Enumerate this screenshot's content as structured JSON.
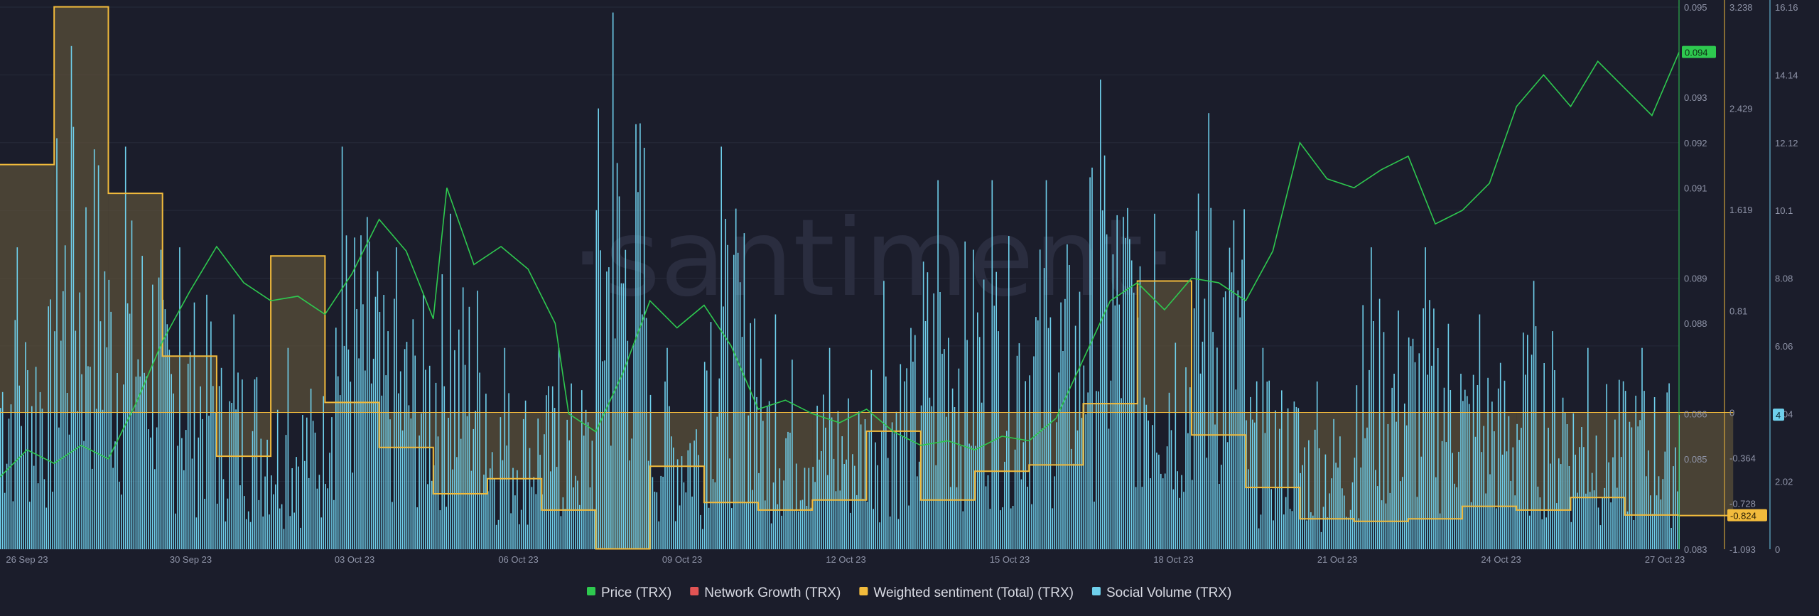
{
  "watermark": "·santiment·",
  "colors": {
    "background": "#1b1d2b",
    "grid": "#262a3b",
    "price": "#2ec94f",
    "network_growth": "#e25454",
    "sentiment": "#f2bb3c",
    "sentiment_fill": "#5a4f3a",
    "social_volume": "#6fd0ec",
    "tick_text": "#8f94a8"
  },
  "chart_data": {
    "type": "line",
    "title": "",
    "x_axis": {
      "type": "date",
      "range": [
        "2023-09-26",
        "2023-10-27"
      ],
      "tick_labels": [
        "26 Sep 23",
        "30 Sep 23",
        "03 Oct 23",
        "06 Oct 23",
        "09 Oct 23",
        "12 Oct 23",
        "15 Oct 23",
        "18 Oct 23",
        "21 Oct 23",
        "24 Oct 23",
        "27 Oct 23"
      ]
    },
    "y_axes": {
      "price": {
        "range": [
          0.083,
          0.095
        ],
        "tick_labels": [
          "0.095",
          "0.093",
          "0.092",
          "0.091",
          "0.089",
          "0.088",
          "0.086",
          "0.085",
          "0.083"
        ],
        "current_value_label": "0.094"
      },
      "sentiment": {
        "range": [
          -1.093,
          3.238
        ],
        "tick_labels": [
          "3.238",
          "2.429",
          "1.619",
          "0.81",
          "0",
          "-0.364",
          "-0.728",
          "-1.093"
        ],
        "current_value_label": "-0.824"
      },
      "social_volume": {
        "range": [
          0,
          16.16
        ],
        "tick_labels": [
          "16.16",
          "14.14",
          "12.12",
          "10.1",
          "8.08",
          "6.06",
          "4.04",
          "2.02",
          "0"
        ],
        "current_value_label": "4"
      }
    },
    "legend": {
      "placement": "bottom-center",
      "entries": [
        {
          "name": "Price (TRX)",
          "color": "#2ec94f"
        },
        {
          "name": "Network Growth (TRX)",
          "color": "#e25454"
        },
        {
          "name": "Weighted sentiment (Total) (TRX)",
          "color": "#f2bb3c"
        },
        {
          "name": "Social Volume (TRX)",
          "color": "#6fd0ec"
        }
      ]
    },
    "series": [
      {
        "name": "Price (TRX)",
        "type": "line",
        "axis": "price",
        "points": [
          [
            "2023-09-26T00:00",
            0.0846
          ],
          [
            "2023-09-26T12:00",
            0.0852
          ],
          [
            "2023-09-27T00:00",
            0.0849
          ],
          [
            "2023-09-27T12:00",
            0.0853
          ],
          [
            "2023-09-28T00:00",
            0.085
          ],
          [
            "2023-09-28T12:00",
            0.0862
          ],
          [
            "2023-09-29T00:00",
            0.0876
          ],
          [
            "2023-09-29T12:00",
            0.0887
          ],
          [
            "2023-09-30T00:00",
            0.0897
          ],
          [
            "2023-09-30T12:00",
            0.0889
          ],
          [
            "2023-10-01T00:00",
            0.0885
          ],
          [
            "2023-10-01T12:00",
            0.0886
          ],
          [
            "2023-10-02T00:00",
            0.0882
          ],
          [
            "2023-10-02T12:00",
            0.0891
          ],
          [
            "2023-10-03T00:00",
            0.0903
          ],
          [
            "2023-10-03T12:00",
            0.0896
          ],
          [
            "2023-10-04T00:00",
            0.0881
          ],
          [
            "2023-10-04T06:00",
            0.091
          ],
          [
            "2023-10-04T18:00",
            0.0893
          ],
          [
            "2023-10-05T06:00",
            0.0897
          ],
          [
            "2023-10-05T18:00",
            0.0892
          ],
          [
            "2023-10-06T06:00",
            0.088
          ],
          [
            "2023-10-06T12:00",
            0.086
          ],
          [
            "2023-10-07T00:00",
            0.0856
          ],
          [
            "2023-10-07T12:00",
            0.0869
          ],
          [
            "2023-10-08T00:00",
            0.0885
          ],
          [
            "2023-10-08T12:00",
            0.0879
          ],
          [
            "2023-10-09T00:00",
            0.0884
          ],
          [
            "2023-10-09T12:00",
            0.0875
          ],
          [
            "2023-10-10T00:00",
            0.0861
          ],
          [
            "2023-10-10T12:00",
            0.0863
          ],
          [
            "2023-10-11T00:00",
            0.086
          ],
          [
            "2023-10-11T12:00",
            0.0858
          ],
          [
            "2023-10-12T00:00",
            0.0861
          ],
          [
            "2023-10-12T12:00",
            0.0856
          ],
          [
            "2023-10-13T00:00",
            0.0853
          ],
          [
            "2023-10-13T12:00",
            0.0854
          ],
          [
            "2023-10-14T00:00",
            0.0852
          ],
          [
            "2023-10-14T12:00",
            0.0855
          ],
          [
            "2023-10-15T00:00",
            0.0854
          ],
          [
            "2023-10-15T12:00",
            0.0859
          ],
          [
            "2023-10-16T00:00",
            0.0872
          ],
          [
            "2023-10-16T12:00",
            0.0885
          ],
          [
            "2023-10-17T00:00",
            0.0889
          ],
          [
            "2023-10-17T12:00",
            0.0883
          ],
          [
            "2023-10-18T00:00",
            0.089
          ],
          [
            "2023-10-18T12:00",
            0.0889
          ],
          [
            "2023-10-19T00:00",
            0.0885
          ],
          [
            "2023-10-19T12:00",
            0.0896
          ],
          [
            "2023-10-20T00:00",
            0.092
          ],
          [
            "2023-10-20T12:00",
            0.0912
          ],
          [
            "2023-10-21T00:00",
            0.091
          ],
          [
            "2023-10-21T12:00",
            0.0914
          ],
          [
            "2023-10-22T00:00",
            0.0917
          ],
          [
            "2023-10-22T12:00",
            0.0902
          ],
          [
            "2023-10-23T00:00",
            0.0905
          ],
          [
            "2023-10-23T12:00",
            0.0911
          ],
          [
            "2023-10-24T00:00",
            0.0928
          ],
          [
            "2023-10-24T12:00",
            0.0935
          ],
          [
            "2023-10-25T00:00",
            0.0928
          ],
          [
            "2023-10-25T12:00",
            0.0938
          ],
          [
            "2023-10-26T00:00",
            0.0932
          ],
          [
            "2023-10-26T12:00",
            0.0926
          ],
          [
            "2023-10-27T00:00",
            0.094
          ]
        ]
      },
      {
        "name": "Weighted sentiment (Total) (TRX)",
        "type": "step",
        "axis": "sentiment",
        "points": [
          [
            "2023-09-26",
            1.98
          ],
          [
            "2023-09-27",
            3.24
          ],
          [
            "2023-09-28",
            1.75
          ],
          [
            "2023-09-29",
            0.45
          ],
          [
            "2023-09-30",
            -0.35
          ],
          [
            "2023-10-01",
            1.25
          ],
          [
            "2023-10-02",
            0.08
          ],
          [
            "2023-10-03",
            -0.28
          ],
          [
            "2023-10-04",
            -0.65
          ],
          [
            "2023-10-05",
            -0.53
          ],
          [
            "2023-10-06",
            -0.78
          ],
          [
            "2023-10-07",
            -1.09
          ],
          [
            "2023-10-08",
            -0.43
          ],
          [
            "2023-10-09",
            -0.72
          ],
          [
            "2023-10-10",
            -0.78
          ],
          [
            "2023-10-11",
            -0.7
          ],
          [
            "2023-10-12",
            -0.15
          ],
          [
            "2023-10-13",
            -0.7
          ],
          [
            "2023-10-14",
            -0.47
          ],
          [
            "2023-10-15",
            -0.42
          ],
          [
            "2023-10-16",
            0.07
          ],
          [
            "2023-10-17",
            1.05
          ],
          [
            "2023-10-18",
            -0.18
          ],
          [
            "2023-10-19",
            -0.6
          ],
          [
            "2023-10-20",
            -0.85
          ],
          [
            "2023-10-21",
            -0.87
          ],
          [
            "2023-10-22",
            -0.85
          ],
          [
            "2023-10-23",
            -0.75
          ],
          [
            "2023-10-24",
            -0.78
          ],
          [
            "2023-10-25",
            -0.68
          ],
          [
            "2023-10-26",
            -0.82
          ],
          [
            "2023-10-27",
            -0.824
          ]
        ]
      },
      {
        "name": "Social Volume (TRX)",
        "type": "bar",
        "axis": "social_volume",
        "note": "daily values",
        "points": [
          [
            "2023-09-26",
            9
          ],
          [
            "2023-09-27",
            15
          ],
          [
            "2023-09-28",
            12
          ],
          [
            "2023-09-29",
            9
          ],
          [
            "2023-09-30",
            7
          ],
          [
            "2023-10-01",
            6
          ],
          [
            "2023-10-02",
            12
          ],
          [
            "2023-10-03",
            9
          ],
          [
            "2023-10-04",
            10
          ],
          [
            "2023-10-05",
            6
          ],
          [
            "2023-10-06",
            6
          ],
          [
            "2023-10-07",
            16
          ],
          [
            "2023-10-08",
            6
          ],
          [
            "2023-10-09",
            12
          ],
          [
            "2023-10-10",
            7
          ],
          [
            "2023-10-11",
            6
          ],
          [
            "2023-10-12",
            8
          ],
          [
            "2023-10-13",
            11
          ],
          [
            "2023-10-14",
            11
          ],
          [
            "2023-10-15",
            11
          ],
          [
            "2023-10-16",
            14
          ],
          [
            "2023-10-17",
            10
          ],
          [
            "2023-10-18",
            13
          ],
          [
            "2023-10-19",
            6
          ],
          [
            "2023-10-20",
            5
          ],
          [
            "2023-10-21",
            9
          ],
          [
            "2023-10-22",
            9
          ],
          [
            "2023-10-23",
            7
          ],
          [
            "2023-10-24",
            8
          ],
          [
            "2023-10-25",
            6
          ],
          [
            "2023-10-26",
            6
          ],
          [
            "2023-10-27",
            4
          ]
        ]
      },
      {
        "name": "Network Growth (TRX)",
        "type": "line",
        "axis": "price",
        "points": []
      }
    ]
  }
}
